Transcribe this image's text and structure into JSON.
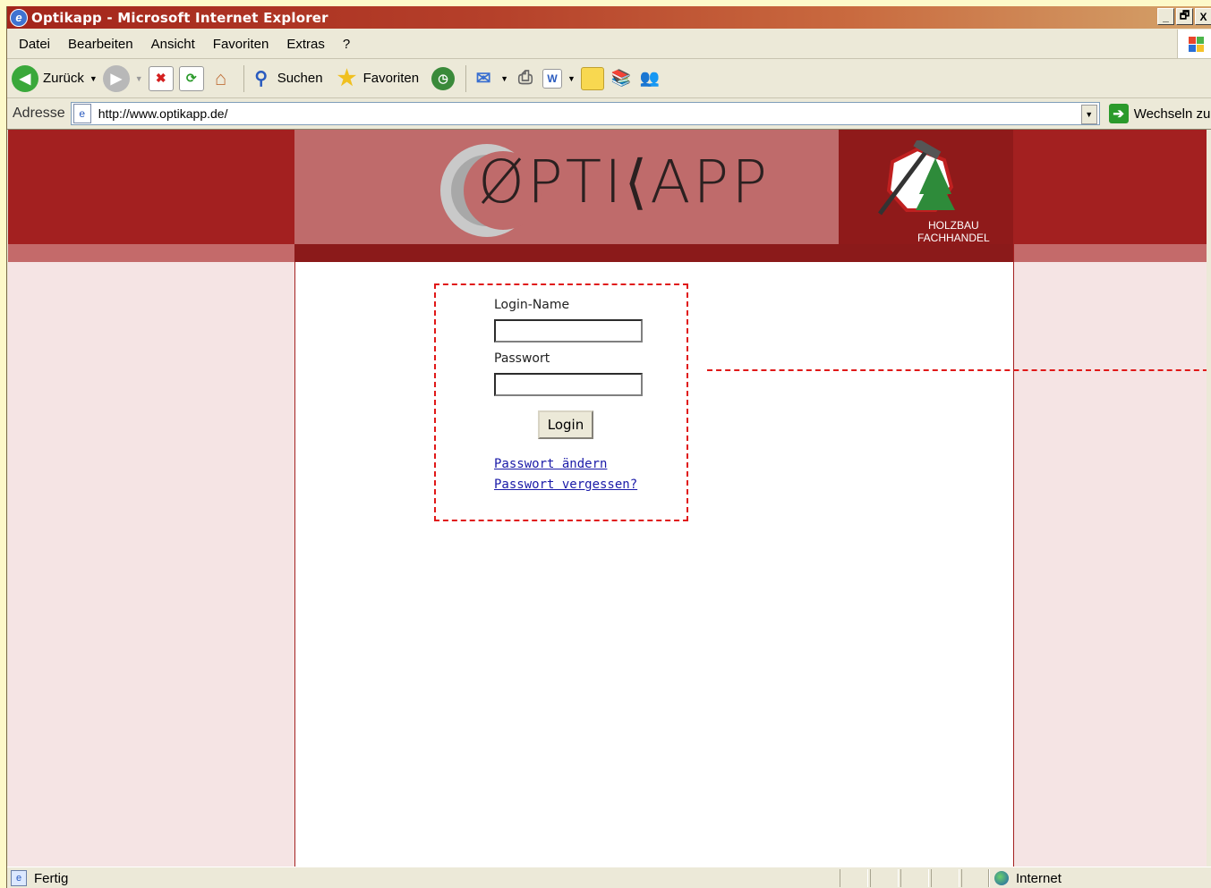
{
  "window": {
    "title": "Optikapp - Microsoft Internet Explorer",
    "controls": {
      "minimize": "_",
      "restore": "🗗",
      "close": "X"
    }
  },
  "menu": {
    "items": [
      "Datei",
      "Bearbeiten",
      "Ansicht",
      "Favoriten",
      "Extras",
      "?"
    ]
  },
  "toolbar": {
    "back": "Zurück",
    "search": "Suchen",
    "favorites": "Favoriten"
  },
  "address": {
    "label": "Adresse",
    "url": "http://www.optikapp.de/",
    "go_label": "Wechseln zu"
  },
  "header": {
    "logo_text": "ØPTI⟨APP",
    "badge_line1": "HOLZBAU",
    "badge_line2": "FACHHANDEL"
  },
  "login": {
    "username_label": "Login-Name",
    "username_value": "",
    "password_label": "Passwort",
    "password_value": "",
    "submit_label": "Login",
    "link_change": "Passwort ändern",
    "link_forgot": "Passwort vergessen?"
  },
  "status": {
    "text": "Fertig",
    "zone": "Internet"
  },
  "colors": {
    "header_red": "#a32020",
    "logo_bg": "#bf6b6b",
    "side_bg": "#f5e4e4",
    "annotation": "#e01818",
    "link": "#1a1aa8"
  }
}
